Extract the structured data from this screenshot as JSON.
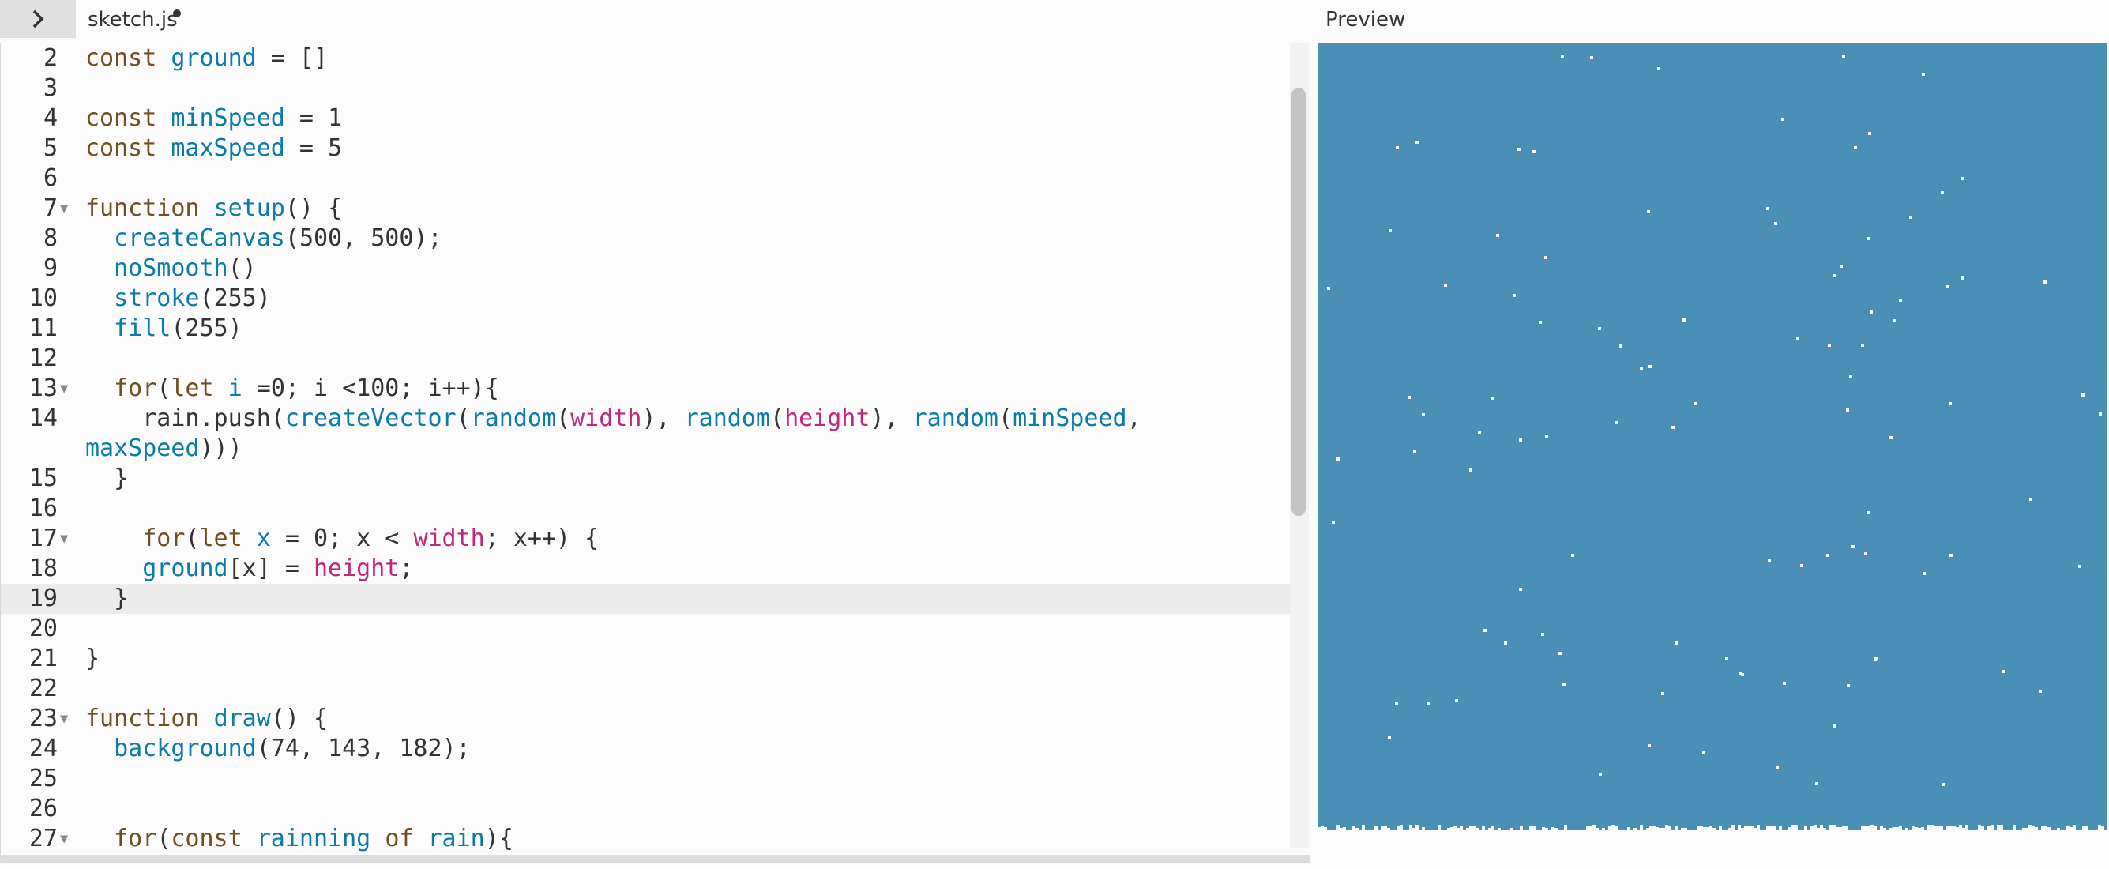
{
  "header": {
    "tab_name": "sketch.js",
    "unsaved": true,
    "toggle_icon": "chevron-right-icon",
    "preview_label": "Preview"
  },
  "editor": {
    "lines": [
      {
        "n": "2",
        "fold": false,
        "active": false,
        "tall": false,
        "tokens": [
          [
            "kw",
            "const "
          ],
          [
            "var",
            "ground"
          ],
          [
            "pu",
            " = []"
          ]
        ]
      },
      {
        "n": "3",
        "fold": false,
        "active": false,
        "tall": false,
        "tokens": []
      },
      {
        "n": "4",
        "fold": false,
        "active": false,
        "tall": false,
        "tokens": [
          [
            "kw",
            "const "
          ],
          [
            "var",
            "minSpeed"
          ],
          [
            "pu",
            " = "
          ],
          [
            "num",
            "1"
          ]
        ]
      },
      {
        "n": "5",
        "fold": false,
        "active": false,
        "tall": false,
        "tokens": [
          [
            "kw",
            "const "
          ],
          [
            "var",
            "maxSpeed"
          ],
          [
            "pu",
            " = "
          ],
          [
            "num",
            "5"
          ]
        ]
      },
      {
        "n": "6",
        "fold": false,
        "active": false,
        "tall": false,
        "tokens": []
      },
      {
        "n": "7",
        "fold": true,
        "active": false,
        "tall": false,
        "tokens": [
          [
            "kw",
            "function "
          ],
          [
            "fn",
            "setup"
          ],
          [
            "pu",
            "() {"
          ]
        ]
      },
      {
        "n": "8",
        "fold": false,
        "active": false,
        "tall": false,
        "tokens": [
          [
            "pu",
            "  "
          ],
          [
            "fn",
            "createCanvas"
          ],
          [
            "pu",
            "("
          ],
          [
            "num",
            "500"
          ],
          [
            "pu",
            ", "
          ],
          [
            "num",
            "500"
          ],
          [
            "pu",
            ");"
          ]
        ]
      },
      {
        "n": "9",
        "fold": false,
        "active": false,
        "tall": false,
        "tokens": [
          [
            "pu",
            "  "
          ],
          [
            "fn",
            "noSmooth"
          ],
          [
            "pu",
            "()"
          ]
        ]
      },
      {
        "n": "10",
        "fold": false,
        "active": false,
        "tall": false,
        "tokens": [
          [
            "pu",
            "  "
          ],
          [
            "fn",
            "stroke"
          ],
          [
            "pu",
            "("
          ],
          [
            "num",
            "255"
          ],
          [
            "pu",
            ")"
          ]
        ]
      },
      {
        "n": "11",
        "fold": false,
        "active": false,
        "tall": false,
        "tokens": [
          [
            "pu",
            "  "
          ],
          [
            "fn",
            "fill"
          ],
          [
            "pu",
            "("
          ],
          [
            "num",
            "255"
          ],
          [
            "pu",
            ")"
          ]
        ]
      },
      {
        "n": "12",
        "fold": false,
        "active": false,
        "tall": false,
        "tokens": []
      },
      {
        "n": "13",
        "fold": true,
        "active": false,
        "tall": false,
        "tokens": [
          [
            "pu",
            "  "
          ],
          [
            "kw",
            "for"
          ],
          [
            "pu",
            "("
          ],
          [
            "kw",
            "let "
          ],
          [
            "var",
            "i"
          ],
          [
            "pu",
            " ="
          ],
          [
            "num",
            "0"
          ],
          [
            "pu",
            "; i <"
          ],
          [
            "num",
            "100"
          ],
          [
            "pu",
            "; i++){"
          ]
        ]
      },
      {
        "n": "14",
        "fold": false,
        "active": false,
        "tall": true,
        "tokens": [
          [
            "pu",
            "    rain.push("
          ],
          [
            "fn",
            "createVector"
          ],
          [
            "pu",
            "("
          ],
          [
            "fn",
            "random"
          ],
          [
            "pu",
            "("
          ],
          [
            "env",
            "width"
          ],
          [
            "pu",
            "), "
          ],
          [
            "fn",
            "random"
          ],
          [
            "pu",
            "("
          ],
          [
            "env",
            "height"
          ],
          [
            "pu",
            "), "
          ],
          [
            "fn",
            "random"
          ],
          [
            "pu",
            "("
          ],
          [
            "var",
            "minSpeed"
          ],
          [
            "pu",
            ",\n"
          ],
          [
            "var",
            "maxSpeed"
          ],
          [
            "pu",
            ")))"
          ]
        ]
      },
      {
        "n": "15",
        "fold": false,
        "active": false,
        "tall": false,
        "tokens": [
          [
            "pu",
            "  }"
          ]
        ]
      },
      {
        "n": "16",
        "fold": false,
        "active": false,
        "tall": false,
        "tokens": []
      },
      {
        "n": "17",
        "fold": true,
        "active": false,
        "tall": false,
        "tokens": [
          [
            "pu",
            "    "
          ],
          [
            "kw",
            "for"
          ],
          [
            "pu",
            "("
          ],
          [
            "kw",
            "let "
          ],
          [
            "var",
            "x"
          ],
          [
            "pu",
            " = "
          ],
          [
            "num",
            "0"
          ],
          [
            "pu",
            "; x < "
          ],
          [
            "env",
            "width"
          ],
          [
            "pu",
            "; x++) {"
          ]
        ]
      },
      {
        "n": "18",
        "fold": false,
        "active": false,
        "tall": false,
        "tokens": [
          [
            "pu",
            "    "
          ],
          [
            "var",
            "ground"
          ],
          [
            "pu",
            "[x] = "
          ],
          [
            "env",
            "height"
          ],
          [
            "pu",
            ";"
          ]
        ]
      },
      {
        "n": "19",
        "fold": false,
        "active": true,
        "tall": false,
        "tokens": [
          [
            "pu",
            "  }"
          ]
        ]
      },
      {
        "n": "20",
        "fold": false,
        "active": false,
        "tall": false,
        "tokens": []
      },
      {
        "n": "21",
        "fold": false,
        "active": false,
        "tall": false,
        "tokens": [
          [
            "pu",
            "}"
          ]
        ]
      },
      {
        "n": "22",
        "fold": false,
        "active": false,
        "tall": false,
        "tokens": []
      },
      {
        "n": "23",
        "fold": true,
        "active": false,
        "tall": false,
        "tokens": [
          [
            "kw",
            "function "
          ],
          [
            "fn",
            "draw"
          ],
          [
            "pu",
            "() {"
          ]
        ]
      },
      {
        "n": "24",
        "fold": false,
        "active": false,
        "tall": false,
        "tokens": [
          [
            "pu",
            "  "
          ],
          [
            "fn",
            "background"
          ],
          [
            "pu",
            "("
          ],
          [
            "num",
            "74"
          ],
          [
            "pu",
            ", "
          ],
          [
            "num",
            "143"
          ],
          [
            "pu",
            ", "
          ],
          [
            "num",
            "182"
          ],
          [
            "pu",
            ");"
          ]
        ]
      },
      {
        "n": "25",
        "fold": false,
        "active": false,
        "tall": false,
        "tokens": []
      },
      {
        "n": "26",
        "fold": false,
        "active": false,
        "tall": false,
        "tokens": []
      },
      {
        "n": "27",
        "fold": true,
        "active": false,
        "tall": false,
        "tokens": [
          [
            "pu",
            "  "
          ],
          [
            "kw",
            "for"
          ],
          [
            "pu",
            "("
          ],
          [
            "kw",
            "const "
          ],
          [
            "var",
            "rainning"
          ],
          [
            "pu",
            " "
          ],
          [
            "kw",
            "of "
          ],
          [
            "var",
            "rain"
          ],
          [
            "pu",
            "){"
          ]
        ]
      }
    ]
  },
  "preview": {
    "background": "#4a8fb6",
    "particle_color": "#ffffff",
    "ground_color": "#fbfbfb",
    "particle_count": 100
  }
}
